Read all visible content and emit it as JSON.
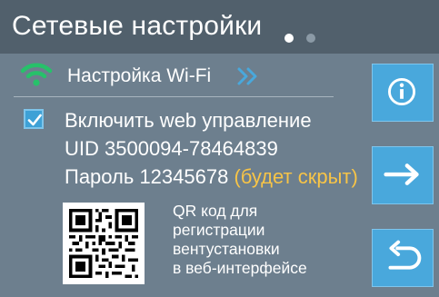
{
  "header": {
    "title": "Сетевые настройки",
    "page_dots": [
      {
        "state": "active"
      },
      {
        "state": "inactive"
      }
    ]
  },
  "wifi": {
    "icon": "wifi-icon",
    "label": "Настройка Wi-Fi",
    "chevron_icon": "double-chevron-right-icon"
  },
  "web_control": {
    "checkbox_checked": true,
    "label": "Включить web управление",
    "uid": "UID 3500094-78464839",
    "password_prefix": "Пароль 12345678",
    "password_note": "(будет скрыт)"
  },
  "qr": {
    "icon": "qr-code",
    "caption_lines": [
      "QR код для",
      "регистрации",
      "вентустановки",
      "в веб-интерфейсе"
    ]
  },
  "side_buttons": [
    {
      "icon": "info-icon"
    },
    {
      "icon": "arrow-right-icon"
    },
    {
      "icon": "back-arrow-icon"
    }
  ],
  "colors": {
    "background": "#6d7f8e",
    "titlebar": "#51606c",
    "accent_blue": "#49a8dc",
    "wifi_green": "#27c16a",
    "note_yellow": "#f7c447"
  }
}
